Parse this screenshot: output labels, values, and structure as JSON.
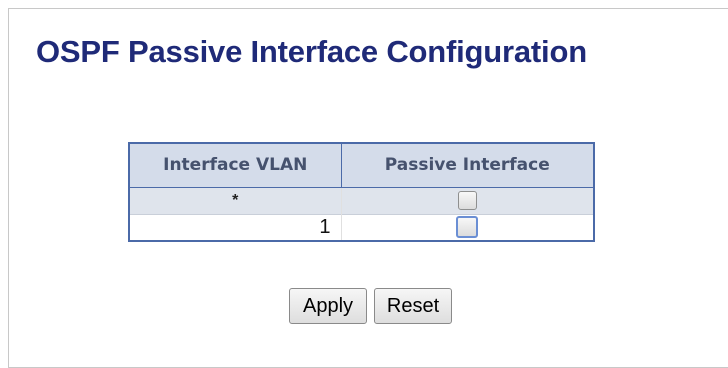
{
  "page": {
    "title": "OSPF Passive Interface Configuration"
  },
  "table": {
    "headers": {
      "interface_vlan": "Interface VLAN",
      "passive_interface": "Passive Interface"
    },
    "rows": [
      {
        "vlan": "*",
        "passive": false
      },
      {
        "vlan": "1",
        "passive": false
      }
    ]
  },
  "buttons": {
    "apply": "Apply",
    "reset": "Reset"
  },
  "colors": {
    "title": "#1f2a78",
    "table_border": "#4b6aa8",
    "header_bg": "#d4dcea",
    "all_row_bg": "#dfe4ec"
  }
}
